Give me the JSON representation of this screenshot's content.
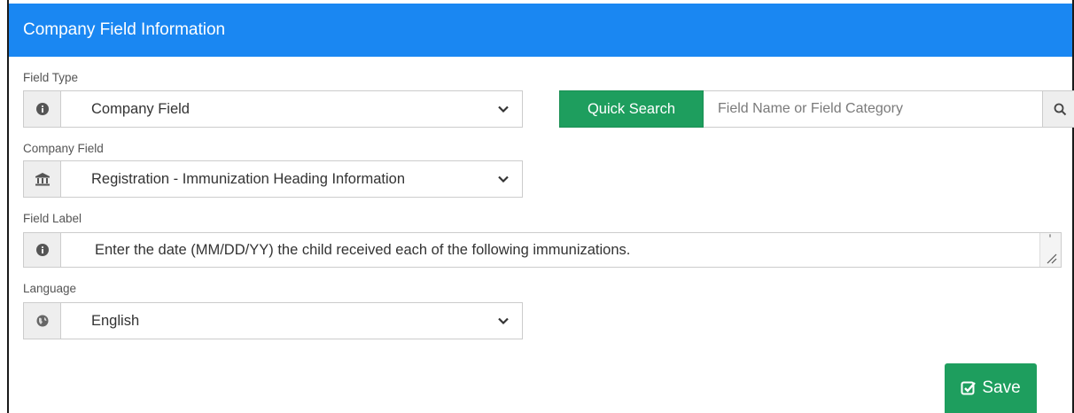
{
  "header": {
    "title": "Company Field Information"
  },
  "field_type": {
    "label": "Field Type",
    "value": "Company Field",
    "icon": "info-circle-icon"
  },
  "quick_search": {
    "button_label": "Quick Search",
    "placeholder": "Field Name or Field Category",
    "search_icon": "search-icon"
  },
  "company_field": {
    "label": "Company Field",
    "value": "Registration - Immunization Heading Information",
    "icon": "bank-icon"
  },
  "field_label": {
    "label": "Field Label",
    "value": "Enter the date (MM/DD/YY) the child received each of the following immunizations.",
    "icon": "info-circle-icon"
  },
  "language": {
    "label": "Language",
    "value": "English",
    "icon": "globe-icon"
  },
  "save": {
    "label": "Save",
    "icon": "check-square-icon"
  },
  "colors": {
    "header": "#1a87f2",
    "primary_button": "#1e9e5e"
  }
}
